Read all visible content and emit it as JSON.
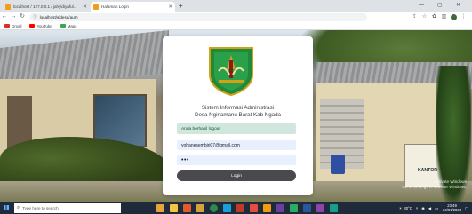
{
  "browser": {
    "tabs": [
      {
        "title": "localhost / 127.0.0.1 / jahyidiyaful...",
        "active": false,
        "favicon_color": "#f29d1b"
      },
      {
        "title": "Halaman Login",
        "active": true,
        "favicon_color": "#f29d1b"
      }
    ],
    "new_tab_icon": "plus-icon",
    "url": "localhost/sidesa/auth",
    "bookmarks": [
      {
        "label": "Gmail",
        "icon_color": "#d93025"
      },
      {
        "label": "YouTube",
        "icon_color": "#ff0000"
      },
      {
        "label": "Maps",
        "icon_color": "#34a853"
      }
    ]
  },
  "login": {
    "title_line1": "Sistem Informasi Administrasi",
    "title_line2": "Desa Nginamanu Barat Kab Ngada",
    "alert": "Anda berhasil logout",
    "email_value": "yohanesembiri07@gmail.com",
    "password_value": "•••",
    "login_button": "Login"
  },
  "scene": {
    "sign_text": "KANTOR"
  },
  "watermark": {
    "line1": "Activate Windows",
    "line2": "Go to Settings to activate Windows."
  },
  "taskbar": {
    "search_placeholder": "Type here to search",
    "weather": "30°C",
    "time": "23.49",
    "date": "24/01/2023"
  },
  "colors": {
    "alert_bg": "#d1e7dd",
    "alert_text": "#0f5132",
    "input_bg": "#e8f0fe",
    "button_bg": "#4a4a4e"
  }
}
